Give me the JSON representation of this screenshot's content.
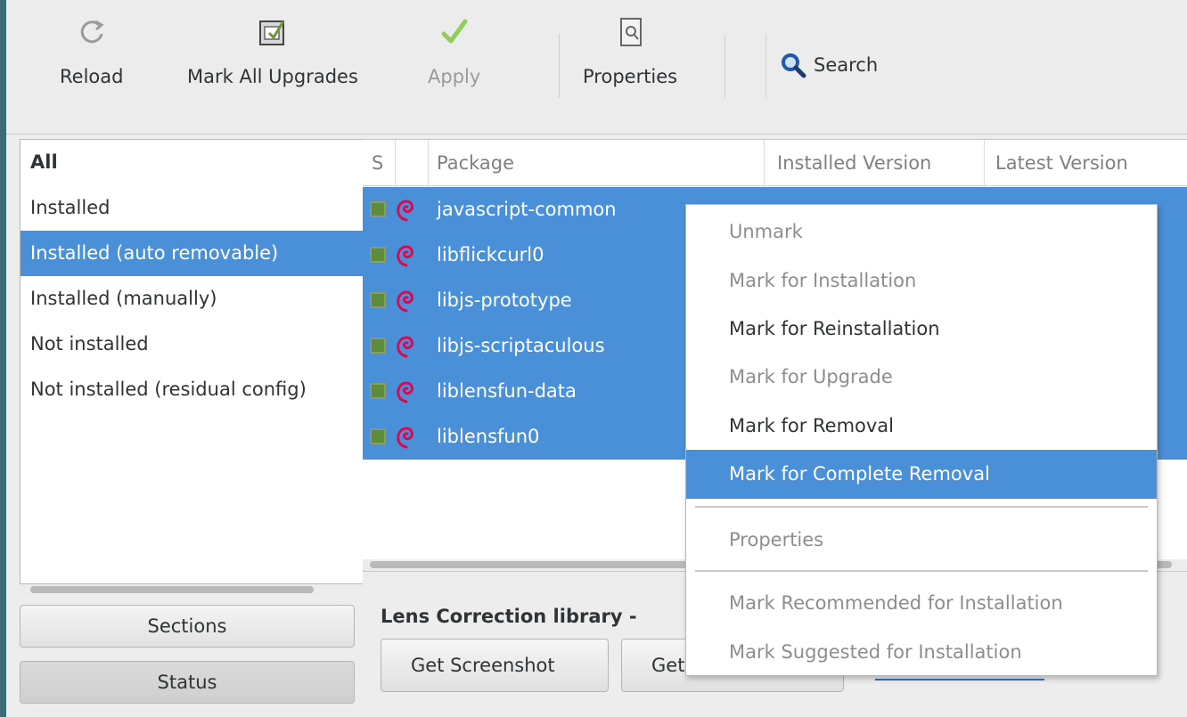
{
  "toolbar": {
    "reload": "Reload",
    "mark_all_upgrades": "Mark All Upgrades",
    "apply": "Apply",
    "properties": "Properties",
    "search": "Search"
  },
  "filters": [
    "All",
    "Installed",
    "Installed (auto removable)",
    "Installed (manually)",
    "Not installed",
    "Not installed (residual config)"
  ],
  "side_buttons": {
    "sections": "Sections",
    "status": "Status"
  },
  "table": {
    "columns": {
      "status": "S",
      "package": "Package",
      "installed_version": "Installed Version",
      "latest_version": "Latest Version"
    },
    "rows": [
      "javascript-common",
      "libflickcurl0",
      "libjs-prototype",
      "libjs-scriptaculous",
      "liblensfun-data",
      "liblensfun0"
    ]
  },
  "description": {
    "title": "Lens Correction library -",
    "get_screenshot": "Get Screenshot",
    "get_partial": "Get"
  },
  "context_menu": {
    "unmark": "Unmark",
    "mark_install": "Mark for Installation",
    "mark_reinstall": "Mark for Reinstallation",
    "mark_upgrade": "Mark for Upgrade",
    "mark_removal": "Mark for Removal",
    "mark_complete_removal": "Mark for Complete Removal",
    "properties": "Properties",
    "mark_recommended": "Mark Recommended for Installation",
    "mark_suggested": "Mark Suggested for Installation"
  },
  "colors": {
    "selection": "#4a90d9",
    "checkbox": "#5d8c3a",
    "debian_swirl": "#d70a53"
  }
}
